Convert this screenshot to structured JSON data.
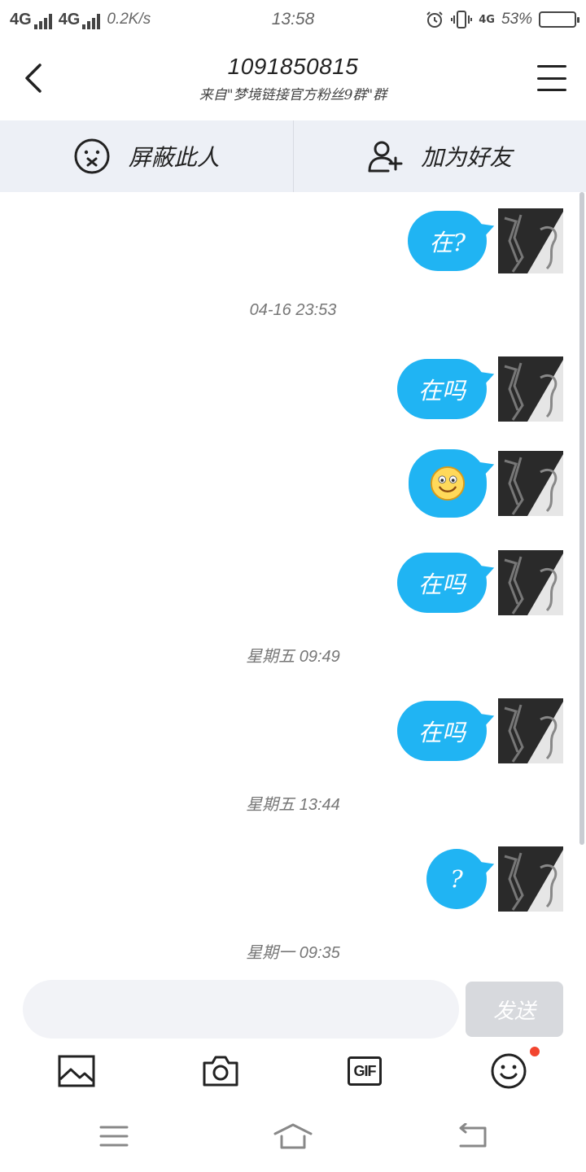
{
  "status_bar": {
    "network1": "4G",
    "network2": "4G",
    "speed": "0.2K/s",
    "time": "13:58",
    "mini_network": "4G",
    "battery_text": "53%",
    "battery_level": 0.53,
    "battery_color": "#f5b81c"
  },
  "header": {
    "title": "1091850815",
    "subtitle": "来自\"梦境链接官方粉丝9群\"群"
  },
  "actions": {
    "block_label": "屏蔽此人",
    "add_friend_label": "加为好友"
  },
  "messages": [
    {
      "type": "text",
      "text": "在?"
    },
    {
      "type": "timestamp",
      "text": "04-16 23:53"
    },
    {
      "type": "text",
      "text": "在吗"
    },
    {
      "type": "emoji",
      "icon": "smiley-emoji"
    },
    {
      "type": "text",
      "text": "在吗"
    },
    {
      "type": "timestamp",
      "text": "星期五 09:49"
    },
    {
      "type": "text",
      "text": "在吗"
    },
    {
      "type": "timestamp",
      "text": "星期五 13:44"
    },
    {
      "type": "text",
      "text": "?"
    },
    {
      "type": "timestamp",
      "text": "星期一 09:35"
    }
  ],
  "input": {
    "placeholder": "",
    "send_label": "发送"
  },
  "toolbar": {
    "icons": [
      "image-icon",
      "camera-icon",
      "gif-icon",
      "emoji-icon"
    ],
    "gif_text": "GIF"
  },
  "colors": {
    "bubble": "#20b4f3",
    "action_bar_bg": "#edf0f6",
    "badge": "#f2452f"
  }
}
